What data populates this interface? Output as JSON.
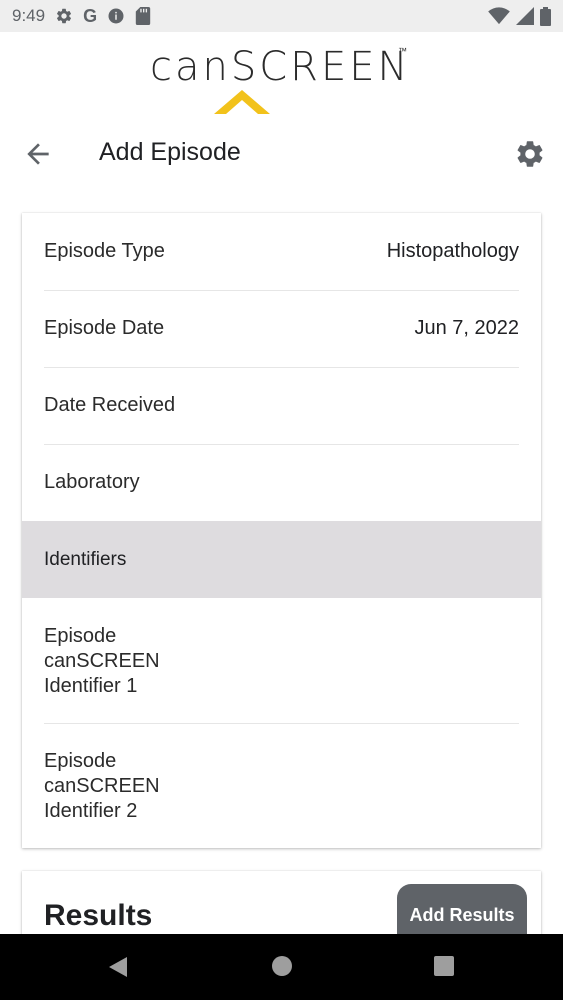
{
  "status_bar": {
    "time": "9:49",
    "icons": [
      "gear-icon",
      "google-icon",
      "info-icon",
      "sd-card-icon",
      "wifi-icon",
      "signal-icon",
      "battery-icon"
    ],
    "google_glyph": "G"
  },
  "logo": {
    "text": "canSCREEN",
    "trademark": "™",
    "accent_color": "#f2c21b"
  },
  "app_bar": {
    "title": "Add Episode"
  },
  "episode_fields": [
    {
      "label": "Episode Type",
      "value": "Histopathology"
    },
    {
      "label": "Episode Date",
      "value": "Jun 7, 2022"
    },
    {
      "label": "Date Received",
      "value": ""
    },
    {
      "label": "Laboratory",
      "value": ""
    }
  ],
  "identifiers": {
    "header": "Identifiers",
    "items": [
      {
        "label": "Episode canSCREEN Identifier 1",
        "value": ""
      },
      {
        "label": "Episode canSCREEN Identifier 2",
        "value": ""
      }
    ]
  },
  "results": {
    "title": "Results",
    "add_button": "Add Results"
  },
  "colors": {
    "section_header_bg": "#dedcdf",
    "button_bg": "#5f6368",
    "icon_gray": "#5f6368"
  }
}
